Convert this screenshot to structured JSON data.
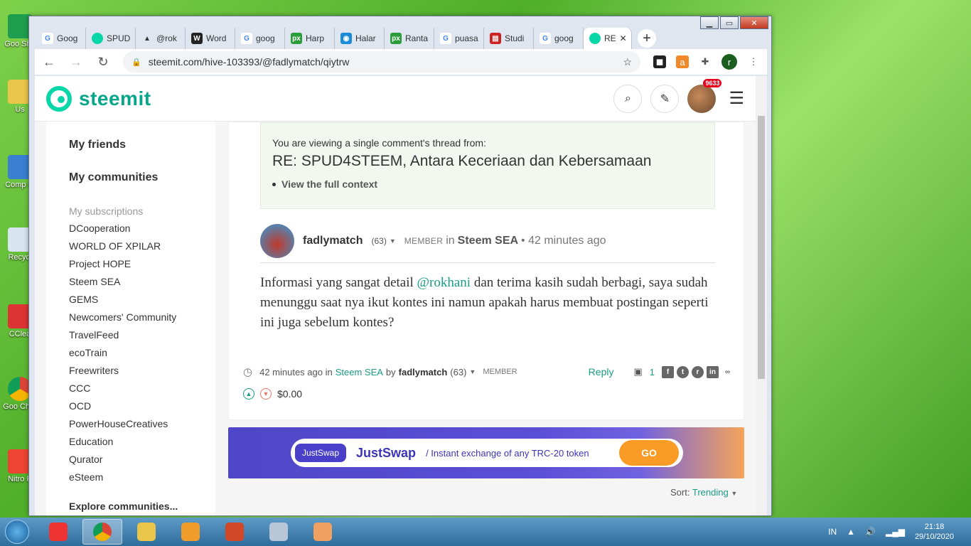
{
  "desktop": {
    "icons": [
      {
        "label": "Goo\nShe",
        "icon": "google-sheets-icon"
      },
      {
        "label": "Us",
        "icon": "folder-icon"
      },
      {
        "label": "Comp\nte",
        "icon": "computer-icon"
      },
      {
        "label": "Recycl",
        "icon": "recycle-bin-icon"
      },
      {
        "label": "CClea",
        "icon": "ccleaner-icon"
      },
      {
        "label": "Goo\nChro",
        "icon": "chrome-icon"
      },
      {
        "label": "Nitro P",
        "icon": "nitro-pdf-icon"
      }
    ]
  },
  "browser": {
    "tabs": [
      {
        "label": "Goog",
        "icon": "google-icon"
      },
      {
        "label": "SPUD",
        "icon": "steemit-icon"
      },
      {
        "label": "@rok",
        "icon": "steemit-a-icon"
      },
      {
        "label": "Word",
        "icon": "wordpress-icon"
      },
      {
        "label": "goog",
        "icon": "google-icon"
      },
      {
        "label": "Harp",
        "icon": "px-icon"
      },
      {
        "label": "Halar",
        "icon": "halaman-icon"
      },
      {
        "label": "Ranta",
        "icon": "px-icon"
      },
      {
        "label": "puasa",
        "icon": "google-icon"
      },
      {
        "label": "Studi",
        "icon": "news-icon"
      },
      {
        "label": "goog",
        "icon": "google-icon"
      },
      {
        "label": "RE",
        "icon": "steemit-icon",
        "active": true
      }
    ],
    "url": "steemit.com/hive-103393/@fadlymatch/qiytrw",
    "profile_initial": "r"
  },
  "site": {
    "logo": "steemit",
    "notification_count": "9633"
  },
  "sidebar": {
    "my_friends": "My friends",
    "my_communities": "My communities",
    "subscriptions_label": "My subscriptions",
    "items": [
      "DCooperation",
      "WORLD OF XPILAR",
      "Project HOPE",
      "Steem SEA",
      "GEMS",
      "Newcomers' Community",
      "TravelFeed",
      "ecoTrain",
      "Freewriters",
      "CCC",
      "OCD",
      "PowerHouseCreatives",
      "Education",
      "Qurator",
      "eSteem"
    ],
    "explore": "Explore communities..."
  },
  "comment": {
    "context_label": "You are viewing a single comment's thread from:",
    "context_title": "RE: SPUD4STEEM, Antara Keceriaan dan Kebersamaan",
    "context_link": "View the full context",
    "author": "fadlymatch",
    "reputation": "(63)",
    "role": "MEMBER",
    "in_word": "in",
    "community": "Steem SEA",
    "time": "• 42 minutes ago",
    "body_before": "Informasi yang sangat detail ",
    "mention": "@rokhani",
    "body_after": " dan terima kasih sudah berbagi, saya sudah menunggu saat nya ikut kontes ini namun apakah harus membuat postingan seperti ini juga sebelum kontes?",
    "footer_time": "42 minutes ago in",
    "footer_community": "Steem SEA",
    "footer_by": "by",
    "footer_author": "fadlymatch",
    "footer_rep": "(63)",
    "footer_role": "MEMBER",
    "reply": "Reply",
    "reply_count": "1",
    "payout": "$0.00"
  },
  "ad": {
    "logo": "JustSwap",
    "name": "JustSwap",
    "tagline": "/ Instant exchange of any TRC-20 token",
    "cta": "GO"
  },
  "sort": {
    "label": "Sort:",
    "value": "Trending"
  },
  "taskbar": {
    "lang": "IN",
    "time": "21:18",
    "date": "29/10/2020"
  }
}
